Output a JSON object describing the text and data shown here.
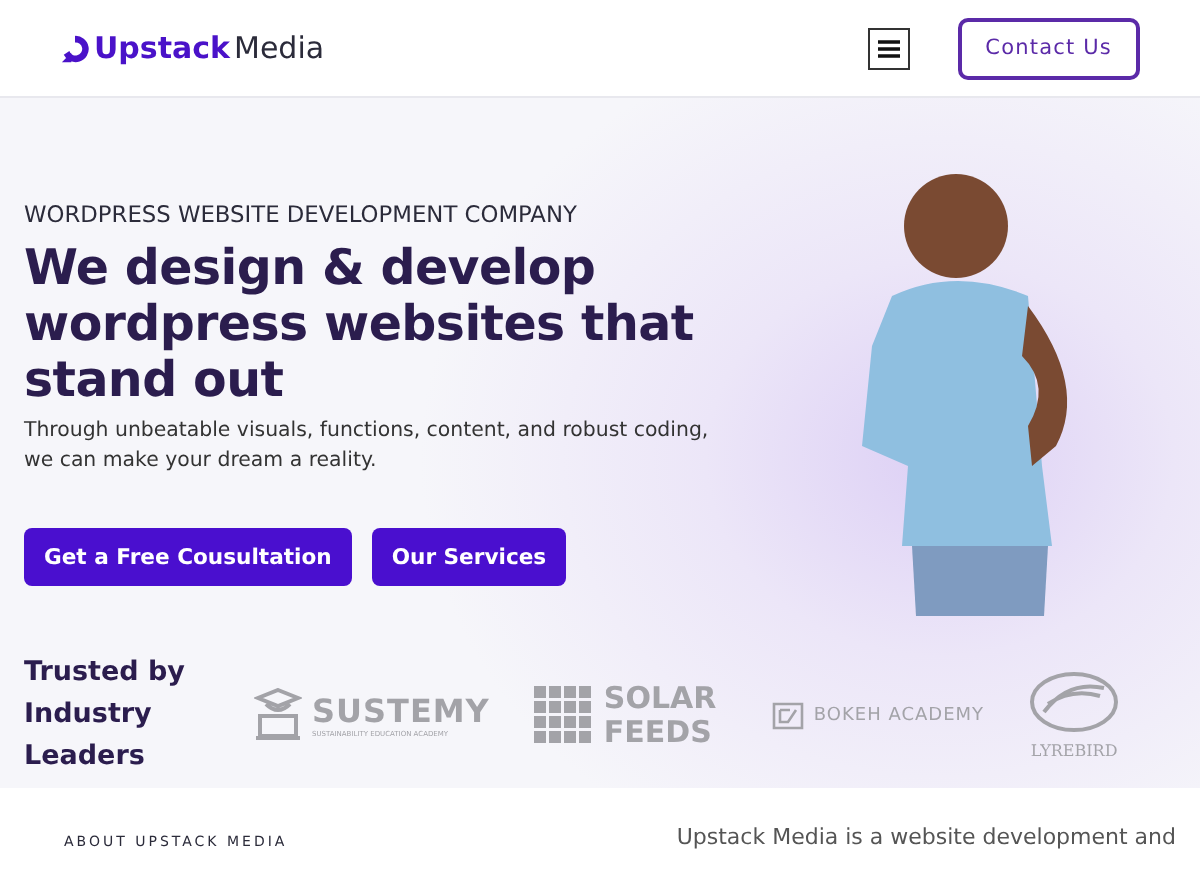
{
  "header": {
    "logo": {
      "brand": "Upstack",
      "suffix": "Media"
    },
    "contact_button": "Contact Us"
  },
  "hero": {
    "kicker": "WORDPRESS WEBSITE DEVELOPMENT COMPANY",
    "headline": "We design & develop wordpress websites that stand out",
    "description": "Through unbeatable visuals, functions, content, and robust coding, we can make your dream a reality.",
    "buttons": [
      "Get a Free Cousultation",
      "Our Services"
    ]
  },
  "trusted": {
    "title": "Trusted by Industry Leaders",
    "logos": [
      {
        "kind": "sustemy",
        "name": "SUSTEMY",
        "tagline": "SUSTAINABILITY EDUCATION ACADEMY"
      },
      {
        "kind": "solar",
        "name": "SOLAR FEEDS"
      },
      {
        "kind": "bokeh",
        "name": "BOKEH ACADEMY"
      },
      {
        "kind": "lyrebird",
        "name": "LYREBIRD"
      }
    ]
  },
  "about": {
    "kicker": "ABOUT UPSTACK MEDIA",
    "intro": "Upstack Media is a website development and"
  }
}
